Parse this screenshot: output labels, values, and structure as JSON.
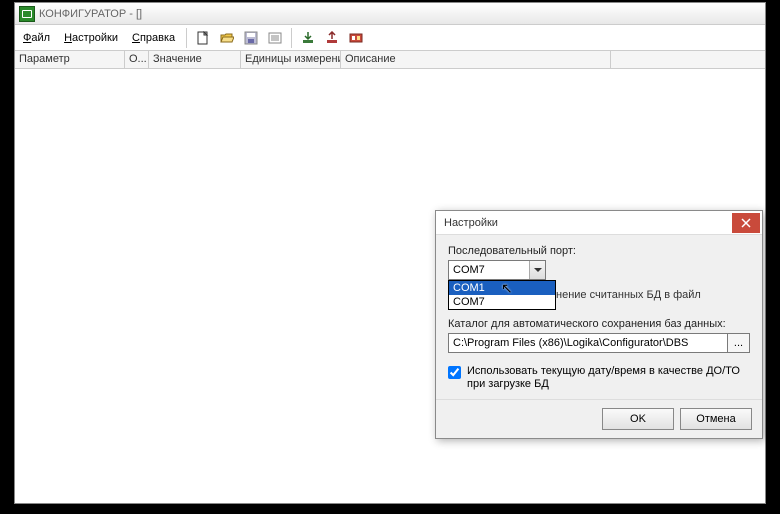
{
  "titlebar": {
    "title": "КОНФИГУРАТОР - []"
  },
  "menubar": {
    "items": [
      {
        "label": "Файл",
        "ul": "Ф"
      },
      {
        "label": "Настройки",
        "ul": "Н"
      },
      {
        "label": "Справка",
        "ul": "С"
      }
    ]
  },
  "columns": {
    "parameter": "Параметр",
    "o": "О...",
    "value": "Значение",
    "units": "Единицы измерения",
    "description": "Описание"
  },
  "dialog": {
    "title": "Настройки",
    "serial_port_label": "Последовательный порт:",
    "serial_port_value": "COM7",
    "serial_port_options": [
      "COM1",
      "COM7"
    ],
    "auto_save_trail": "нение считанных БД в файл",
    "catalog_label": "Каталог для автоматического сохранения баз данных:",
    "catalog_value": "C:\\Program Files (x86)\\Logika\\Configurator\\DBS",
    "browse_glyph": "...",
    "use_date_label": "Использовать текущую дату/время в качестве ДО/ТО при загрузке БД",
    "ok": "OK",
    "cancel": "Отмена"
  }
}
